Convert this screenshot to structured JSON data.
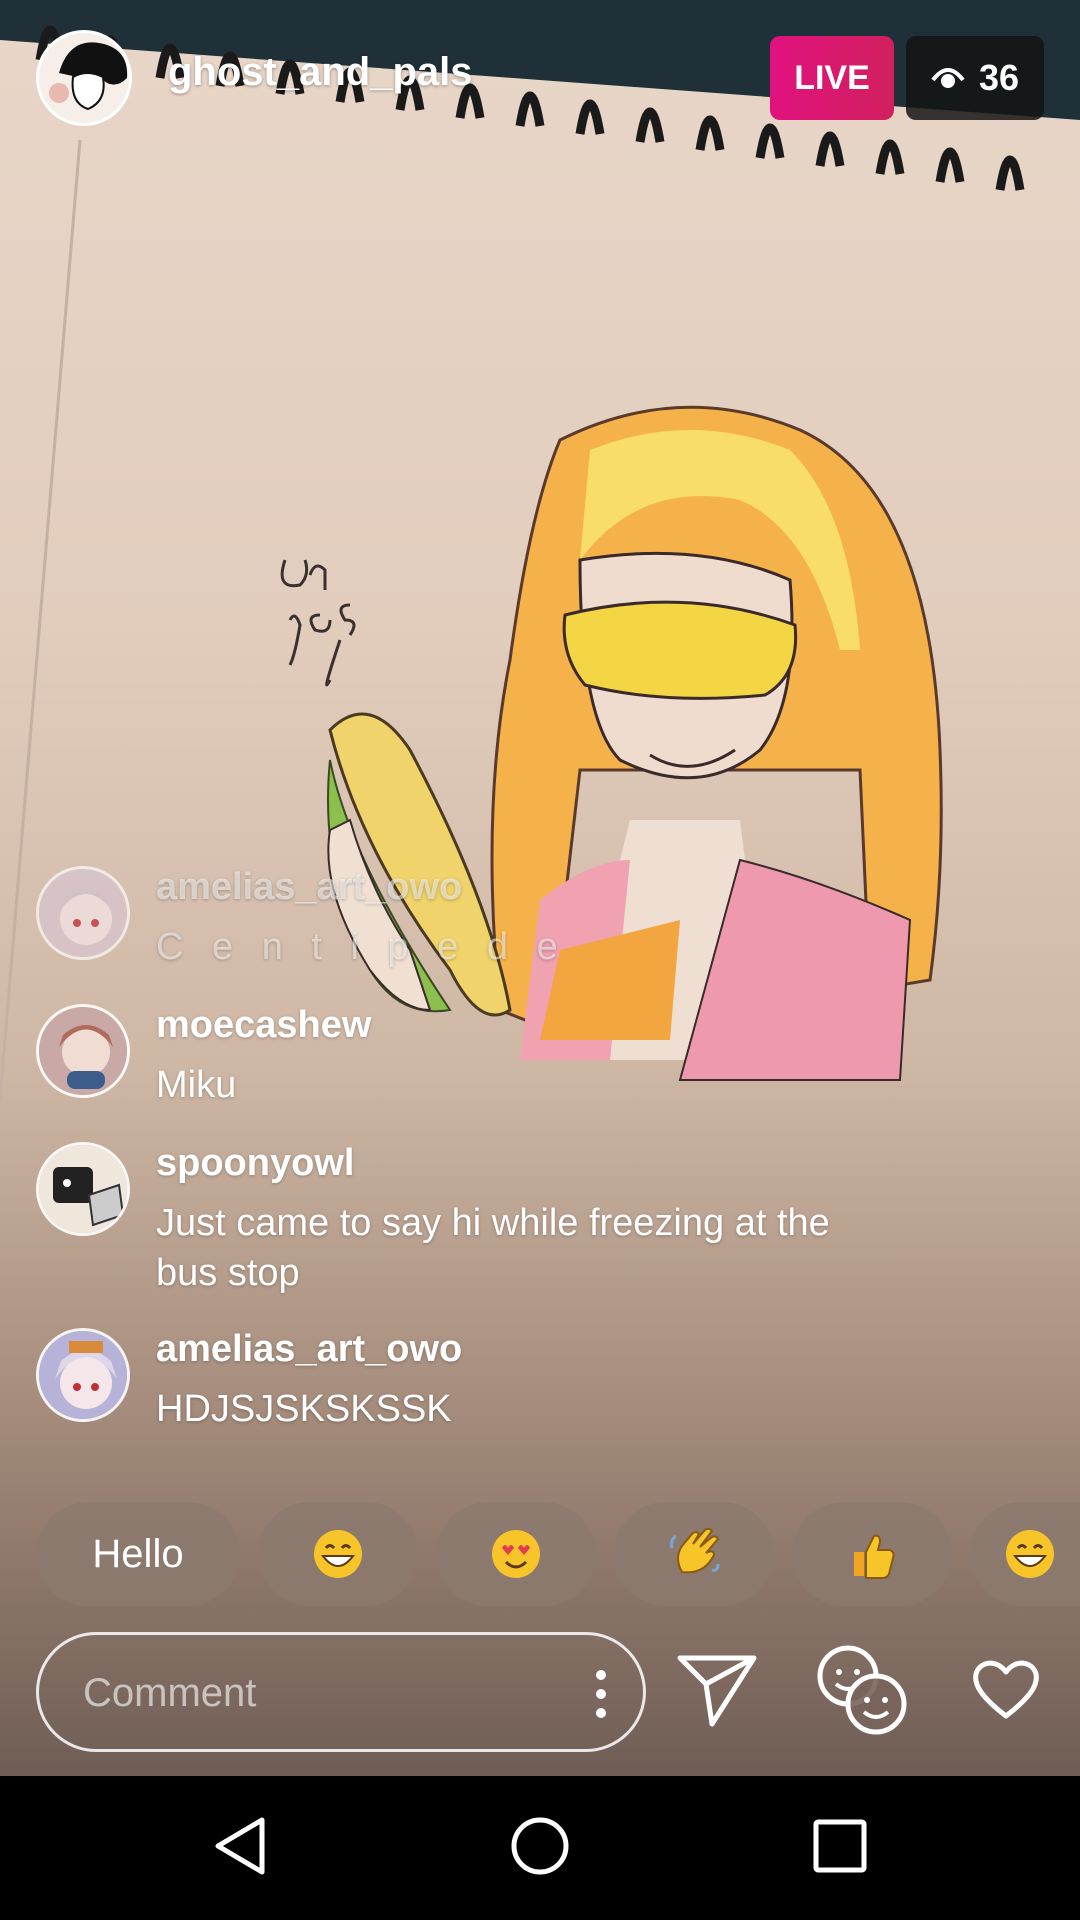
{
  "header": {
    "host_username": "ghost_and_pals",
    "live_label": "LIVE",
    "viewer_count": "36",
    "live_color": "#e1117f"
  },
  "comments": [
    {
      "user": "amelias_art_owo",
      "text": "C e n t i p e d e",
      "faded": true
    },
    {
      "user": "moecashew",
      "text": "Miku",
      "faded": false
    },
    {
      "user": "spoonyowl",
      "text": "Just came to say hi while freezing at the bus stop",
      "faded": false
    },
    {
      "user": "amelias_art_owo",
      "text": "HDJSJSKSKSSK",
      "faded": false
    }
  ],
  "quick_replies": [
    {
      "label": "Hello",
      "icon": "text"
    },
    {
      "label": "",
      "icon": "grinning-face-icon"
    },
    {
      "label": "",
      "icon": "heart-eyes-face-icon"
    },
    {
      "label": "",
      "icon": "waving-hand-icon"
    },
    {
      "label": "",
      "icon": "thumbs-up-icon"
    },
    {
      "label": "",
      "icon": "grinning-face-icon"
    }
  ],
  "composer": {
    "placeholder": "Comment",
    "icons": [
      "more-options-icon",
      "send-icon",
      "face-filter-icon",
      "heart-icon"
    ]
  },
  "navigation": {
    "icons": [
      "back-icon",
      "home-icon",
      "recents-icon"
    ]
  }
}
